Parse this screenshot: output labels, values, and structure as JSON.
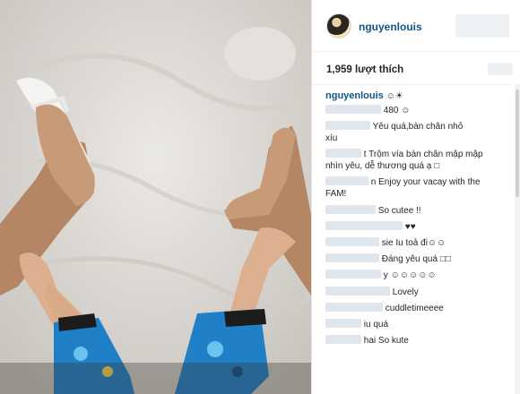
{
  "post": {
    "username": "nguyenlouis",
    "likes_text": "1,959 lượt thích",
    "caption_user": "nguyenlouis",
    "caption_text": "☺☀"
  },
  "comments": [
    {
      "text": "480 ☺"
    },
    {
      "text": "Yêu quá,bàn chân nhỏ"
    },
    {
      "text": "xíu"
    },
    {
      "text": "t Trộm vía bàn chân mập mập"
    },
    {
      "text": "nhìn yêu, dễ thương quá ạ □"
    },
    {
      "text": "n Enjoy your vacay with the"
    },
    {
      "text": "FAM!"
    },
    {
      "text": "So cutee !!"
    },
    {
      "text": "♥♥"
    },
    {
      "text": "sie Iu toả đi☺☺"
    },
    {
      "text": "Đáng yêu quá □□"
    },
    {
      "text": "y ☺☺☺☺☺"
    },
    {
      "text": "Lovely"
    },
    {
      "text": "cuddletimeeee"
    },
    {
      "text": "iu quá"
    },
    {
      "text": "hai So kute"
    }
  ],
  "icons": {
    "avatar": "profile-avatar"
  }
}
